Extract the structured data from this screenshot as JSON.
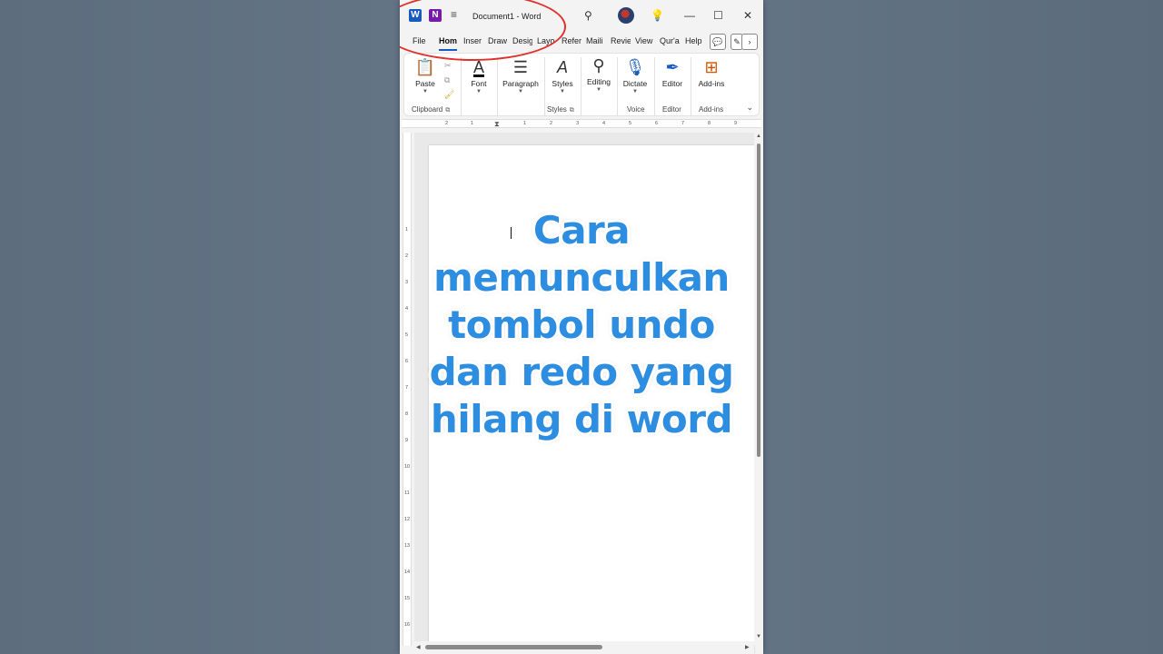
{
  "titlebar": {
    "app_icon_glyph": "W",
    "secondary_icon_glyph": "N",
    "doc_title": "Document1  -  Word",
    "icons": [
      "search-icon",
      "lightbulb-icon",
      "minimize-icon",
      "maximize-icon",
      "close-icon"
    ]
  },
  "tabs": [
    "File",
    "Hom",
    "Inser",
    "Draw",
    "Desig",
    "Layo",
    "Refer",
    "Maili",
    "Revie",
    "View",
    "Qur'a",
    "Help"
  ],
  "active_tab": "Hom",
  "ribbon": {
    "paste": "Paste",
    "font": "Font",
    "paragraph": "Paragraph",
    "styles": "Styles",
    "editing": "Editing",
    "dictate": "Dictate",
    "editor": "Editor",
    "addins": "Add-ins",
    "groups": {
      "clipboard": "Clipboard",
      "styles": "Styles",
      "voice": "Voice",
      "editor": "Editor",
      "addins": "Add-ins"
    }
  },
  "ruler": {
    "horizontal": [
      "2",
      "1",
      "1",
      "2",
      "3",
      "4",
      "5",
      "6",
      "7",
      "8",
      "9"
    ],
    "vertical": [
      "1",
      "2",
      "3",
      "4",
      "5",
      "6",
      "7",
      "8",
      "9",
      "10",
      "11",
      "12",
      "13",
      "14",
      "15",
      "16"
    ]
  },
  "overlay": {
    "lines": [
      "Cara",
      "memunculkan",
      "tombol undo",
      "dan redo yang",
      "hilang di word"
    ]
  },
  "colors": {
    "word_blue": "#185abd",
    "overlay_text": "#2d8de0",
    "annotation_red": "#e0322b"
  }
}
